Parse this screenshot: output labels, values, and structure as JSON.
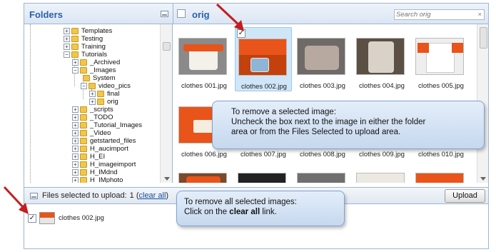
{
  "folders_panel": {
    "title": "Folders",
    "tree": [
      {
        "label": "Templates"
      },
      {
        "label": "Testing"
      },
      {
        "label": "Training"
      },
      {
        "label": "Tutorials"
      },
      {
        "label": "_Archived"
      },
      {
        "label": "_Images"
      },
      {
        "label": "System"
      },
      {
        "label": "video_pics"
      },
      {
        "label": "final"
      },
      {
        "label": "orig"
      },
      {
        "label": "_scripts"
      },
      {
        "label": "_TODO"
      },
      {
        "label": "_Tutorial_Images"
      },
      {
        "label": "_Video"
      },
      {
        "label": "getstarted_files"
      },
      {
        "label": "H_aucimport"
      },
      {
        "label": "H_EI"
      },
      {
        "label": "H_imageimport"
      },
      {
        "label": "H_IMdnd"
      },
      {
        "label": "H_IMphoto"
      }
    ]
  },
  "orig_panel": {
    "title": "orig",
    "search": {
      "placeholder": "Search orig",
      "clear": "×"
    },
    "images": [
      {
        "label": "clothes 001.jpg",
        "checked": false
      },
      {
        "label": "clothes 002.jpg",
        "checked": true,
        "check_mark": "✓"
      },
      {
        "label": "clothes 003.jpg",
        "checked": false
      },
      {
        "label": "clothes 004.jpg",
        "checked": false
      },
      {
        "label": "clothes 005.jpg",
        "checked": false
      },
      {
        "label": "clothes 006.jpg",
        "checked": false
      },
      {
        "label": "clothes 007.jpg",
        "checked": false
      },
      {
        "label": "clothes 008.jpg",
        "checked": false
      },
      {
        "label": "clothes 009.jpg",
        "checked": false
      },
      {
        "label": "clothes 010.jpg",
        "checked": false
      }
    ]
  },
  "selected_panel": {
    "title": "Files selected to upload:",
    "count": "1",
    "clear_all": "clear all",
    "upload_label": "Upload",
    "items": [
      {
        "label": "clothes 002.jpg",
        "check_mark": "✓"
      }
    ]
  },
  "callouts": {
    "remove_selected": {
      "line1": "To remove a selected image:",
      "line2": "Uncheck the box next to the image in either the folder",
      "line3": "area or from the Files Selected to upload area."
    },
    "remove_all": {
      "line1": "To remove all selected images:",
      "line2_prefix": "Click on the",
      "line2_bold": "clear all",
      "line2_suffix": "link."
    }
  },
  "colors": {
    "accent": "#2a62a8",
    "selected_bg": "#cfe6f8",
    "arrow": "#c41e1e",
    "shirt_orange": "#e8541a"
  }
}
